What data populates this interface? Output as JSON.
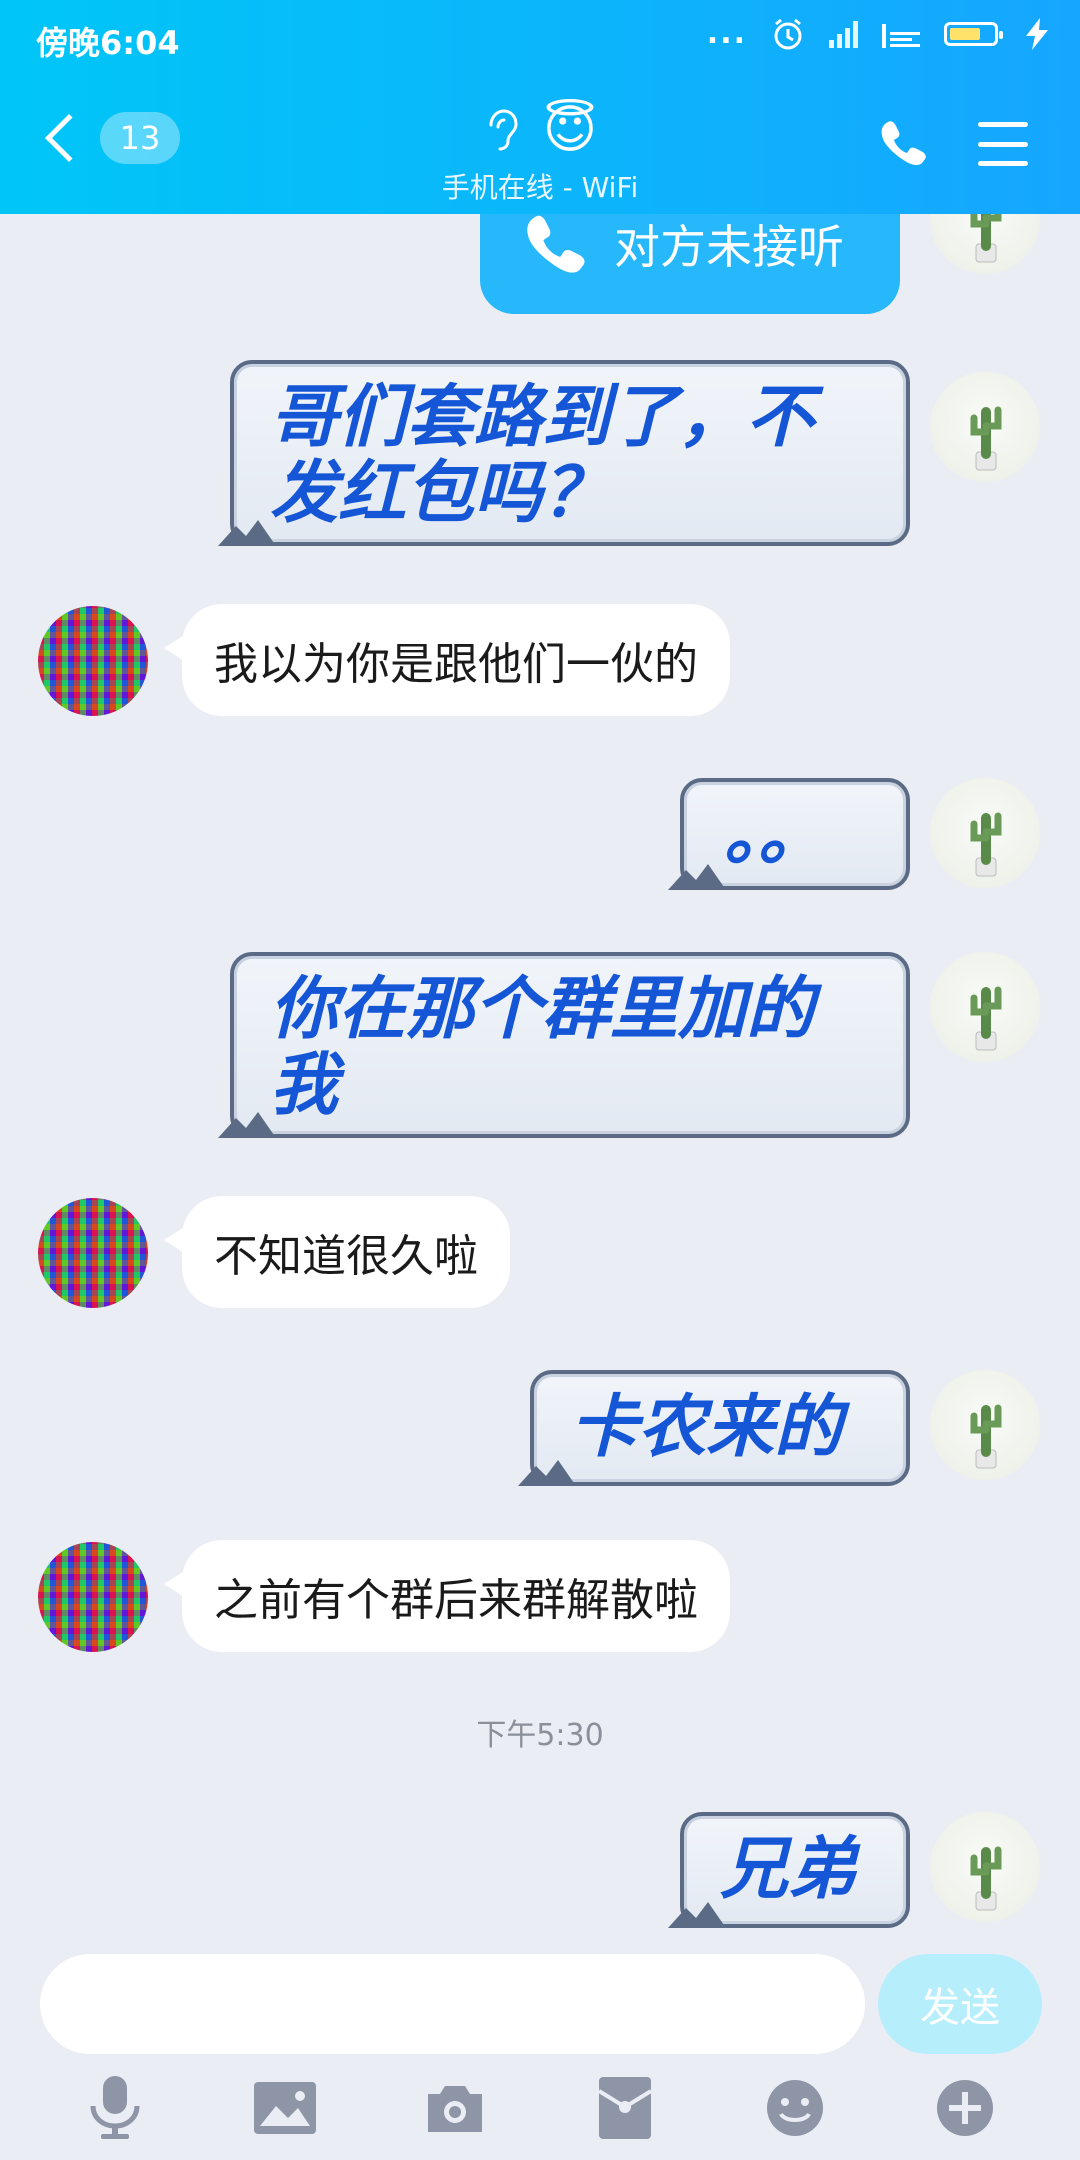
{
  "status_bar": {
    "time": "傍晚6:04",
    "dots": "...",
    "alarm_icon": "alarm-icon",
    "signal_icon": "signal-icon",
    "battery_icon": "battery-icon",
    "charging_icon": "charging-icon"
  },
  "header": {
    "unread_count": "13",
    "listen_icon": "ear-icon",
    "emoji": "😇",
    "subtitle": "手机在线 - WiFi",
    "phone_icon": "phone-icon",
    "menu_icon": "menu-icon"
  },
  "messages": [
    {
      "from": "me",
      "type": "call",
      "text": "对方未接听"
    },
    {
      "from": "me",
      "type": "scroll",
      "text": "哥们套路到了，不发红包吗？"
    },
    {
      "from": "other",
      "type": "text",
      "text": "我以为你是跟他们一伙的"
    },
    {
      "from": "me",
      "type": "scroll",
      "text": "。。"
    },
    {
      "from": "me",
      "type": "scroll",
      "text": "你在那个群里加的我"
    },
    {
      "from": "other",
      "type": "text",
      "text": "不知道很久啦"
    },
    {
      "from": "me",
      "type": "scroll",
      "text": "卡农来的"
    },
    {
      "from": "other",
      "type": "text",
      "text": "之前有个群后来群解散啦"
    },
    {
      "from": "system",
      "type": "time",
      "text": "下午5:30"
    },
    {
      "from": "me",
      "type": "scroll",
      "text": "兄弟"
    }
  ],
  "input": {
    "value": "",
    "placeholder": "",
    "send_label": "发送"
  },
  "toolbar": [
    "microphone-icon",
    "image-icon",
    "camera-icon",
    "red-packet-icon",
    "emoji-icon",
    "plus-icon"
  ],
  "colors": {
    "header_start": "#00c6f7",
    "header_end": "#16a6ff",
    "bubble_text_blue": "#1556d6",
    "background": "#ebedf5",
    "send_disabled": "#b6eefc"
  }
}
